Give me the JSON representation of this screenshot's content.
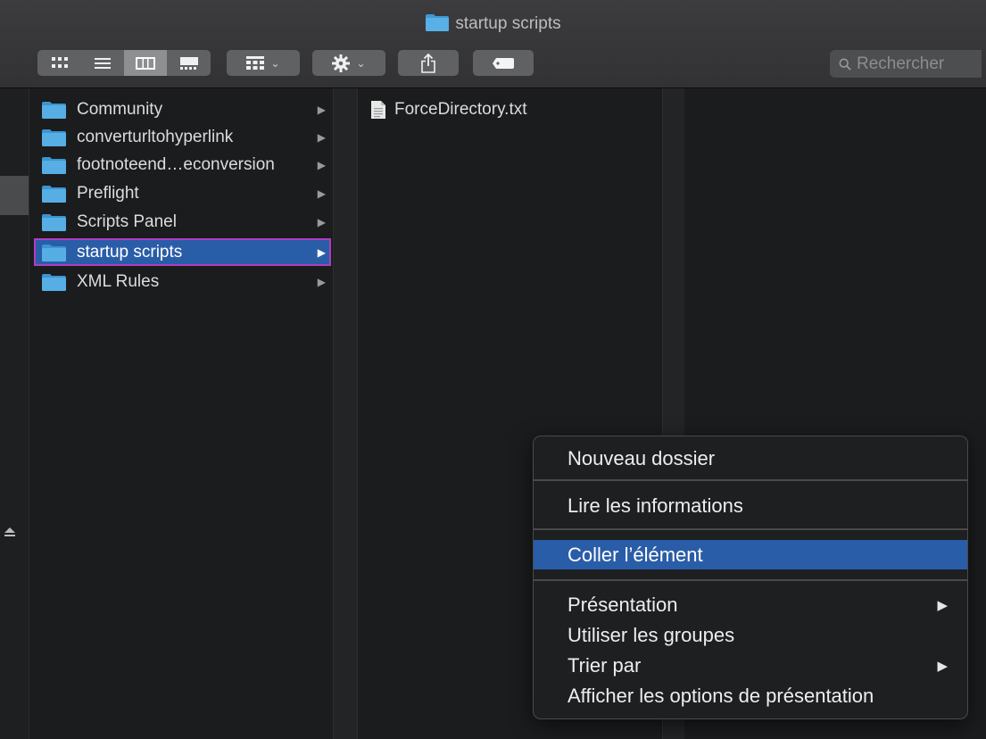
{
  "window": {
    "title": "startup scripts",
    "accent_color": "#2a5da8",
    "folder_color": "#3d9ad6"
  },
  "toolbar": {
    "view_modes": [
      "icon-view-icon",
      "list-view-icon",
      "column-view-icon",
      "gallery-view-icon"
    ],
    "active_view": "column-view-icon",
    "group_caret": "⌄",
    "action_caret": "⌄",
    "search_placeholder": "Rechercher"
  },
  "column1": {
    "items": [
      {
        "label": "Community",
        "arrow": "▶"
      },
      {
        "label": "converturltohyperlink",
        "arrow": "▶"
      },
      {
        "label": "footnoteend…econversion",
        "arrow": "▶"
      },
      {
        "label": "Preflight",
        "arrow": "▶"
      },
      {
        "label": "Scripts Panel",
        "arrow": "▶"
      },
      {
        "label": "startup scripts",
        "arrow": "▶",
        "selected": true
      },
      {
        "label": "XML Rules",
        "arrow": "▶"
      }
    ]
  },
  "column2": {
    "items": [
      {
        "label": "ForceDirectory.txt"
      }
    ]
  },
  "context_menu": {
    "items": [
      {
        "label": "Nouveau dossier"
      },
      {
        "label": "Lire les informations"
      },
      {
        "label": "Coller l’élément",
        "highlighted": true
      },
      {
        "label": "Présentation",
        "arrow": "▶"
      },
      {
        "label": "Utiliser les groupes"
      },
      {
        "label": "Trier par",
        "arrow": "▶"
      },
      {
        "label": "Afficher les options de présentation"
      }
    ]
  }
}
